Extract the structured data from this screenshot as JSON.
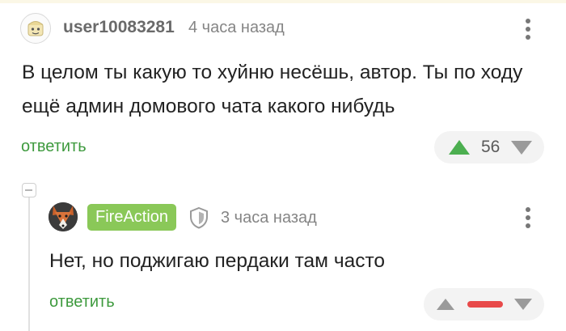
{
  "comments": [
    {
      "author": "user10083281",
      "time": "4 часа назад",
      "text": "В целом ты какую то хуйню несёшь, автор. Ты по ходу ещё админ домового чата какого нибудь",
      "reply_label": "ответить",
      "rating": "56",
      "avatar_icon": "default-avatar-icon",
      "colors": {
        "upvote": "#4caf50",
        "downvote": "#9a9a9a"
      }
    },
    {
      "author": "FireAction",
      "time": "3 часа назад",
      "text": "Нет, но поджигаю пердаки там часто",
      "reply_label": "ответить",
      "badge_icon": "shield-icon",
      "avatar_icon": "fox-avatar-icon",
      "rating_indicator": "negative",
      "colors": {
        "author_badge": "#8ac858",
        "rating_bar": "#e84a4a"
      }
    }
  ]
}
